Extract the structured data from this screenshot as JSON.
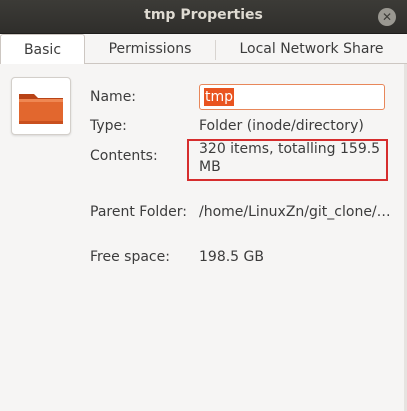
{
  "window": {
    "title": "tmp Properties",
    "close_icon": "close-icon"
  },
  "tabs": [
    {
      "label": "Basic",
      "active": true
    },
    {
      "label": "Permissions",
      "active": false
    },
    {
      "label": "Local Network Share",
      "active": false
    }
  ],
  "icon": "folder-icon",
  "fields": {
    "name": {
      "label": "Name:",
      "value": "tmp"
    },
    "type": {
      "label": "Type:",
      "value": "Folder (inode/directory)"
    },
    "contents": {
      "label": "Contents:",
      "line1": "320 items, totalling 159.5",
      "line2": "MB"
    },
    "parent": {
      "label": "Parent Folder:",
      "value": "/home/LinuxZn/git_clone/…"
    },
    "free": {
      "label": "Free space:",
      "value": "198.5 GB"
    }
  },
  "colors": {
    "accent": "#e95420",
    "highlight_box": "#d62d2d",
    "titlebar": "#3c3b37"
  }
}
